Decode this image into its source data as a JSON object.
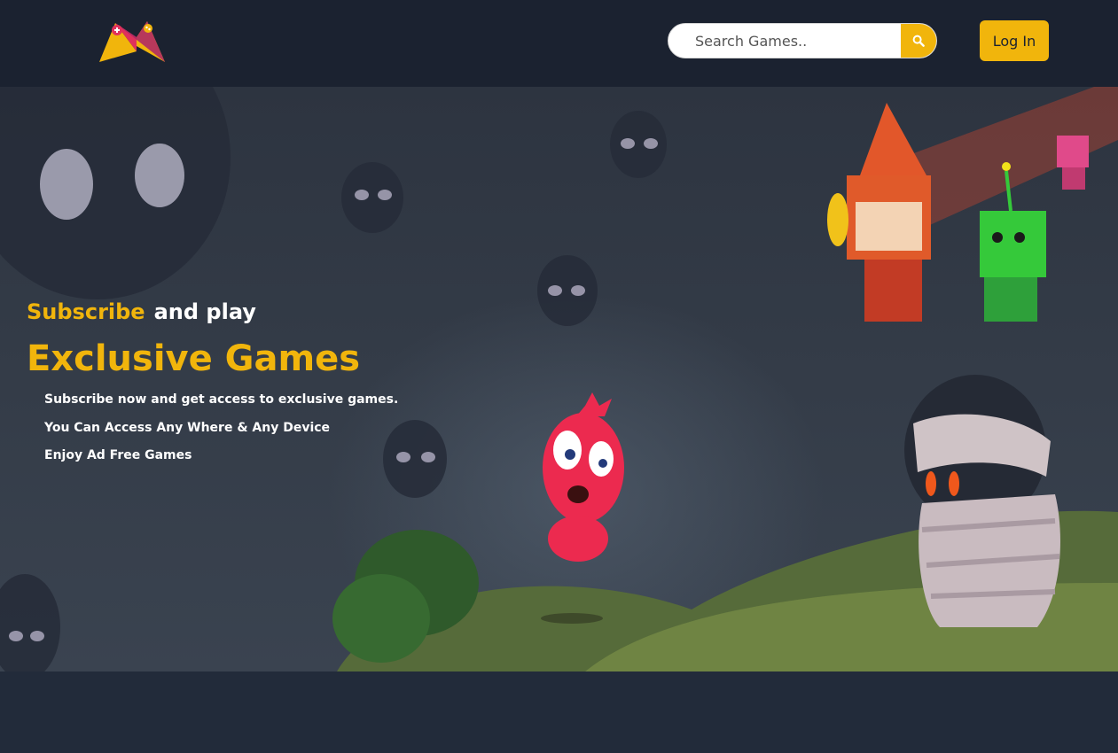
{
  "header": {
    "search": {
      "placeholder": "Search Games.."
    },
    "login_label": "Log In"
  },
  "hero": {
    "title_highlight": "Subscribe",
    "title_rest": "and play",
    "headline": "Exclusive Games",
    "features": [
      "Subscribe now and get access to exclusive games.",
      "You Can Access Any Where & Any Device",
      "Enjoy Ad Free Games"
    ]
  },
  "colors": {
    "accent": "#f1b50c",
    "header_bg": "#1b2230",
    "page_bg": "#222b3a"
  },
  "icons": [
    "logo-icon",
    "search-icon"
  ]
}
